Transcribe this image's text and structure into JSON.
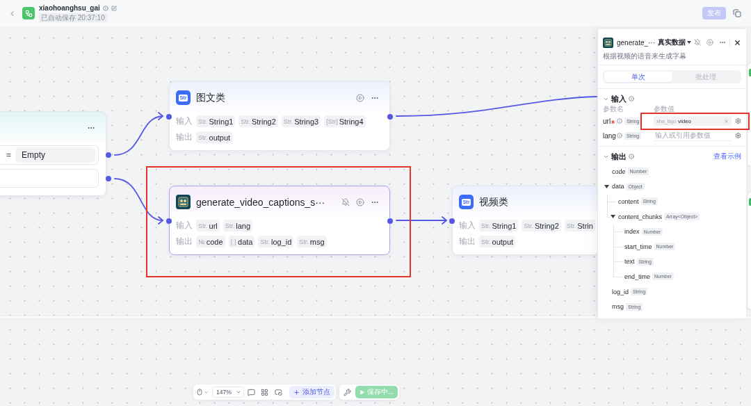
{
  "header": {
    "title": "xiaohoanghsu_gai",
    "saved_status": "已自动保存 20:37:10",
    "publish": {
      "label": "发布",
      "disabled": true
    }
  },
  "canvas": {
    "nodes": [
      {
        "kind": "condition",
        "selected": false,
        "highlighted": false,
        "operator": "=",
        "value": "Empty"
      },
      {
        "kind": "plugin",
        "selected": false,
        "highlighted": false,
        "icon_text": "Str",
        "title": "图文类",
        "input_label": "输入",
        "inputs": [
          {
            "type": "Str.",
            "name": "String1"
          },
          {
            "type": "Str.",
            "name": "String2"
          },
          {
            "type": "Str.",
            "name": "String3"
          },
          {
            "type": "[Str]",
            "name": "String4"
          }
        ],
        "output_label": "输出",
        "outputs": [
          {
            "type": "Str.",
            "name": "output"
          }
        ]
      },
      {
        "kind": "tool",
        "selected": true,
        "highlighted": true,
        "title": "generate_video_captions_s···",
        "input_label": "输入",
        "inputs": [
          {
            "type": "Str.",
            "name": "url"
          },
          {
            "type": "Str.",
            "name": "lang"
          }
        ],
        "output_label": "输出",
        "outputs": [
          {
            "type": "№",
            "name": "code"
          },
          {
            "type": "{ }",
            "name": "data"
          },
          {
            "type": "Str.",
            "name": "log_id"
          },
          {
            "type": "Str.",
            "name": "msg"
          }
        ]
      },
      {
        "kind": "plugin",
        "selected": false,
        "highlighted": false,
        "icon_text": "Str",
        "title": "视频类",
        "input_label": "输入",
        "inputs": [
          {
            "type": "Str.",
            "name": "String1"
          },
          {
            "type": "Str.",
            "name": "String2"
          },
          {
            "type": "Str.",
            "name": "Strin"
          }
        ],
        "output_label": "输出",
        "outputs": [
          {
            "type": "Str.",
            "name": "output"
          }
        ]
      }
    ]
  },
  "panel": {
    "title": "generate_···",
    "data_mode": "真实数据",
    "description": "根据视频的语音来生成字幕",
    "tabs": [
      {
        "label": "单次",
        "selected": true
      },
      {
        "label": "批处理",
        "selected": false
      }
    ],
    "input": {
      "title": "输入",
      "expanded": true,
      "name_header": "参数名",
      "value_header": "参数值",
      "params": [
        {
          "name": "url",
          "required": true,
          "type": "String",
          "reference": "xhs_tiqu",
          "value": "video",
          "highlighted": true
        },
        {
          "name": "lang",
          "required": false,
          "type": "String",
          "placeholder": "输入或引用参数值",
          "highlighted": false
        }
      ]
    },
    "output": {
      "title": "输出",
      "expanded": true,
      "example_link": "查看示例",
      "fields": [
        {
          "name": "code",
          "type": "Number"
        },
        {
          "name": "data",
          "type": "Object",
          "expanded": true,
          "children": [
            {
              "name": "content",
              "type": "String"
            },
            {
              "name": "content_chunks",
              "type": "Array<Object>",
              "expanded": true,
              "children": [
                {
                  "name": "index",
                  "type": "Number"
                },
                {
                  "name": "start_time",
                  "type": "Number"
                },
                {
                  "name": "text",
                  "type": "String"
                },
                {
                  "name": "end_time",
                  "type": "Number"
                }
              ]
            }
          ]
        },
        {
          "name": "log_id",
          "type": "String"
        },
        {
          "name": "msg",
          "type": "String"
        }
      ]
    }
  },
  "toolbar": {
    "zoom": "147%",
    "add_node": "添加节点",
    "save": {
      "label": "保存中...",
      "disabled": true
    }
  }
}
